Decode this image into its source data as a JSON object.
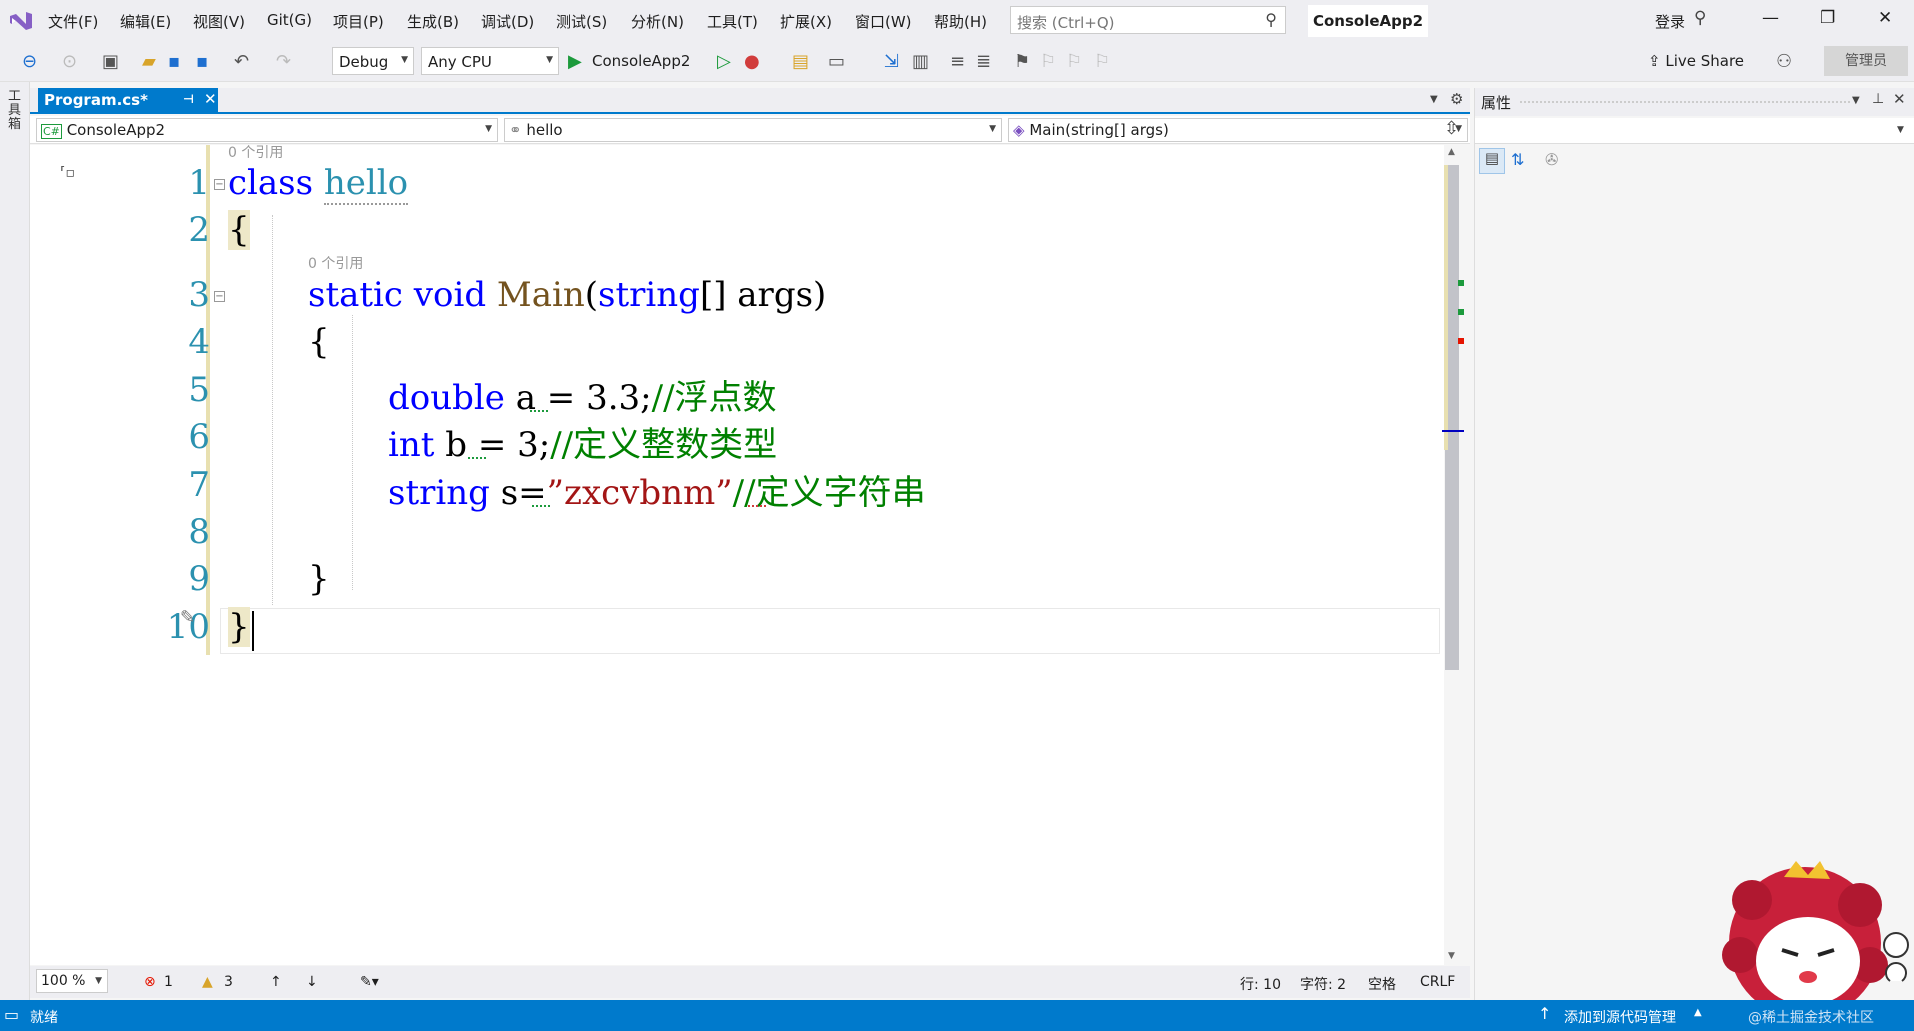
{
  "menu": {
    "items": [
      "文件(F)",
      "编辑(E)",
      "视图(V)",
      "Git(G)",
      "项目(P)",
      "生成(B)",
      "调试(D)",
      "测试(S)",
      "分析(N)",
      "工具(T)",
      "扩展(X)",
      "窗口(W)",
      "帮助(H)"
    ],
    "search_placeholder": "搜索 (Ctrl+Q)",
    "app_name": "ConsoleApp2",
    "login": "登录"
  },
  "toolbar": {
    "config": "Debug",
    "platform": "Any CPU",
    "run_target": "ConsoleApp2",
    "live_share": "Live Share",
    "admin": "管理员"
  },
  "toolbox_label": "工具箱",
  "tab": {
    "title": "Program.cs*"
  },
  "navbar": {
    "project": "ConsoleApp2",
    "type": "hello",
    "member": "Main(string[] args)"
  },
  "editor": {
    "lens_refs": "0 个引用",
    "line_numbers": [
      "1",
      "2",
      "3",
      "4",
      "5",
      "6",
      "7",
      "8",
      "9",
      "10"
    ],
    "code": {
      "l1_kw": "class",
      "l1_name": "hello",
      "l2": "{",
      "l3_static": "static",
      "l3_void": "void",
      "l3_main": "Main",
      "l3_open": "(",
      "l3_string": "string",
      "l3_rest": "[] args)",
      "l4": "{",
      "l5_type": "double",
      "l5_rest": " a = 3.3;",
      "l5_cmt": "//浮点数",
      "l6_type": "int",
      "l6_rest": " b = 3;",
      "l6_cmt": "//定义整数类型",
      "l7_type": "string",
      "l7_rest": " s=",
      "l7_str": "”zxcvbnm”",
      "l7_cmt": "//定义字符串",
      "l9": "}",
      "l10": "}"
    }
  },
  "editor_status": {
    "zoom": "100 %",
    "errors": "1",
    "warnings": "3",
    "line": "行: 10",
    "col": "字符: 2",
    "spaces": "空格",
    "eol": "CRLF"
  },
  "properties": {
    "title": "属性"
  },
  "statusbar": {
    "ready": "就绪",
    "source_control": "添加到源代码管理",
    "watermark": "@稀土掘金技术社区"
  },
  "colors": {
    "accent": "#007acc",
    "keyword": "#0000ff",
    "type": "#2b91af",
    "comment": "#008000",
    "string": "#a31515"
  }
}
